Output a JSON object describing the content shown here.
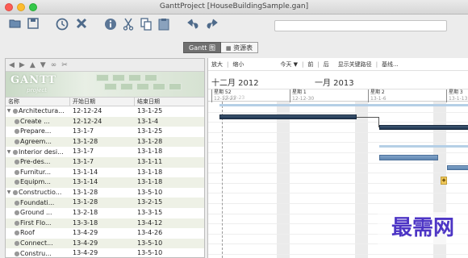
{
  "window": {
    "title": "GanttProject [HouseBuildingSample.gan]"
  },
  "toolbar": {
    "icons": [
      "open-icon",
      "save-icon",
      "clock-icon",
      "delete-icon",
      "info-icon",
      "cut-icon",
      "copy-icon",
      "paste-icon",
      "undo-icon",
      "redo-icon"
    ],
    "search_placeholder": ""
  },
  "tabs": [
    {
      "label": "Gantt 图"
    },
    {
      "label": "资源表"
    }
  ],
  "left_toolbar": {
    "icons": [
      "arrow-left-icon",
      "arrow-right-icon",
      "arrow-up-icon",
      "arrow-down-icon",
      "link-icon",
      "unlink-icon"
    ]
  },
  "banner": {
    "logo": "GANTT",
    "logo_sub": "project"
  },
  "table": {
    "columns": [
      "名称",
      "开始日期",
      "结束日期"
    ],
    "rows": [
      {
        "kind": "group",
        "name": "Architectura...",
        "start": "12-12-24",
        "end": "13-1-25"
      },
      {
        "kind": "task",
        "name": "Create ...",
        "start": "12-12-24",
        "end": "13-1-4"
      },
      {
        "kind": "task",
        "name": "Prepare...",
        "start": "13-1-7",
        "end": "13-1-25"
      },
      {
        "kind": "task",
        "name": "Agreem...",
        "start": "13-1-28",
        "end": "13-1-28"
      },
      {
        "kind": "group",
        "name": "Interior desi...",
        "start": "13-1-7",
        "end": "13-1-18"
      },
      {
        "kind": "task",
        "name": "Pre-des...",
        "start": "13-1-7",
        "end": "13-1-11"
      },
      {
        "kind": "task",
        "name": "Furnitur...",
        "start": "13-1-14",
        "end": "13-1-18"
      },
      {
        "kind": "task",
        "name": "Equipm...",
        "start": "13-1-14",
        "end": "13-1-18"
      },
      {
        "kind": "group",
        "name": "Constructio...",
        "start": "13-1-28",
        "end": "13-5-10"
      },
      {
        "kind": "task",
        "name": "Foundati...",
        "start": "13-1-28",
        "end": "13-2-15"
      },
      {
        "kind": "task",
        "name": "Ground ...",
        "start": "13-2-18",
        "end": "13-3-15"
      },
      {
        "kind": "task",
        "name": "First Flo...",
        "start": "13-3-18",
        "end": "13-4-12"
      },
      {
        "kind": "task",
        "name": "Roof",
        "start": "13-4-29",
        "end": "13-4-26"
      },
      {
        "kind": "task",
        "name": "Connect...",
        "start": "13-4-29",
        "end": "13-5-10"
      },
      {
        "kind": "task",
        "name": "Constru...",
        "start": "13-4-29",
        "end": "13-5-10"
      }
    ]
  },
  "gantt": {
    "tools": [
      "放大",
      "缩小",
      "今天 ▼",
      "前",
      "后",
      "显示关键路径",
      "基线..."
    ],
    "months": [
      "十二月 2012",
      "一月 2013"
    ],
    "weeks": [
      {
        "label": "星期 52",
        "date": "12-12-23"
      },
      {
        "label": "星期 1",
        "date": "12-12-30"
      },
      {
        "label": "星期 2",
        "date": "13-1-6"
      },
      {
        "label": "星期 3",
        "date": "13-1-13"
      }
    ],
    "today_label": "12-12-23"
  },
  "watermark": "最需网"
}
